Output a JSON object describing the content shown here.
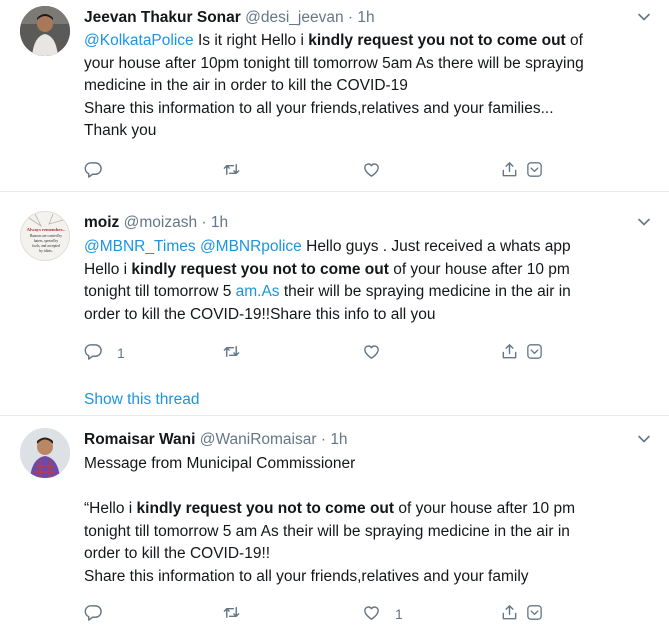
{
  "tweets": [
    {
      "display_name": "Jeevan Thakur Sonar",
      "handle": "@desi_jeevan",
      "dot": "·",
      "time": "1h",
      "lines": [
        [
          {
            "t": "@KolkataPolice",
            "s": "link"
          },
          {
            "t": " Is it right Hello i "
          },
          {
            "t": "kindly request you not to come out",
            "s": "b"
          },
          {
            "t": " of"
          }
        ],
        [
          {
            "t": "your house after 10pm tonight till tomorrow 5am As there will be spraying"
          }
        ],
        [
          {
            "t": "medicine in the air in order to kill the COVID-19"
          }
        ],
        [
          {
            "t": "Share this information to all your friends,relatives and your families..."
          }
        ],
        [
          {
            "t": "Thank you"
          }
        ]
      ],
      "reply_count": "",
      "retweet_count": "",
      "like_count": ""
    },
    {
      "display_name": "moiz",
      "handle": "@moizash",
      "dot": "·",
      "time": "1h",
      "avatar_text": [
        "Always remember...",
        "Rumors are carried by",
        "haters, spread by",
        "fools, and accepted",
        "by idiots."
      ],
      "lines": [
        [
          {
            "t": "@MBNR_Times",
            "s": "link"
          },
          {
            "t": " "
          },
          {
            "t": "@MBNRpolice",
            "s": "link"
          },
          {
            "t": " Hello guys . Just received a whats app"
          }
        ],
        [
          {
            "t": "Hello i "
          },
          {
            "t": "kindly request you not to come out",
            "s": "b"
          },
          {
            "t": " of your house after 10 pm"
          }
        ],
        [
          {
            "t": "tonight till tomorrow 5 "
          },
          {
            "t": "am.As",
            "s": "link"
          },
          {
            "t": " their will be spraying medicine in the air in"
          }
        ],
        [
          {
            "t": "order to kill the COVID-19!!Share this info to all you"
          }
        ]
      ],
      "reply_count": "1",
      "retweet_count": "",
      "like_count": "",
      "show_thread": "Show this thread"
    },
    {
      "display_name": "Romaisar Wani",
      "handle": "@WaniRomaisar",
      "dot": "·",
      "time": "1h",
      "lines": [
        [
          {
            "t": "Message from Municipal Commissioner"
          }
        ],
        [],
        [
          {
            "t": "“Hello i "
          },
          {
            "t": "kindly request you not to come out",
            "s": "b"
          },
          {
            "t": " of your house after 10 pm"
          }
        ],
        [
          {
            "t": "tonight till tomorrow 5 am As their will be spraying medicine in the air in"
          }
        ],
        [
          {
            "t": "order to kill the COVID-19!!"
          }
        ],
        [
          {
            "t": "Share this information to all your friends,relatives and your family"
          }
        ]
      ],
      "reply_count": "",
      "retweet_count": "",
      "like_count": "1"
    }
  ],
  "colors": {
    "link": "#1b95e0",
    "secondary_text": "#657786",
    "divider": "#e6ecf0",
    "primary_text": "#14171a"
  },
  "icons": [
    "reply-icon",
    "retweet-icon",
    "like-icon",
    "share-icon",
    "more-share-icon",
    "caret-down-icon"
  ]
}
